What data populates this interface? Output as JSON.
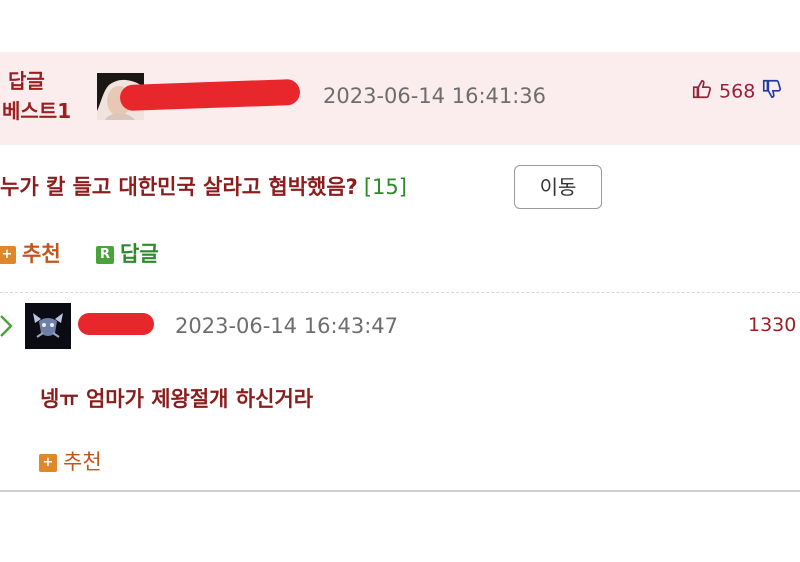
{
  "best_reply": {
    "label_line1": "답글",
    "label_line2": "베스트1",
    "timestamp": "2023-06-14 16:41:36",
    "upvotes": "568"
  },
  "post": {
    "title": "누가 칼 들고 대한민국 살라고 협박했음?",
    "comment_count": "[15]",
    "move_button": "이동",
    "recommend_label": "추천",
    "recommend_badge": "+",
    "reply_label": "답글",
    "reply_badge": "R"
  },
  "reply": {
    "timestamp": "2023-06-14 16:43:47",
    "user_id_partial": "1330",
    "text": "넹ㅠ 엄마가 제왕절개 하신거라",
    "recommend_label": "추천",
    "recommend_badge": "+"
  },
  "colors": {
    "accent_red": "#8a1d1d",
    "header_bg": "#fbeded",
    "badge_orange": "#e0872a",
    "badge_green": "#4aa23a",
    "redaction": "#e8272c"
  },
  "icons": [
    "thumbs-up-icon",
    "thumbs-down-icon",
    "reply-arrow-icon"
  ]
}
